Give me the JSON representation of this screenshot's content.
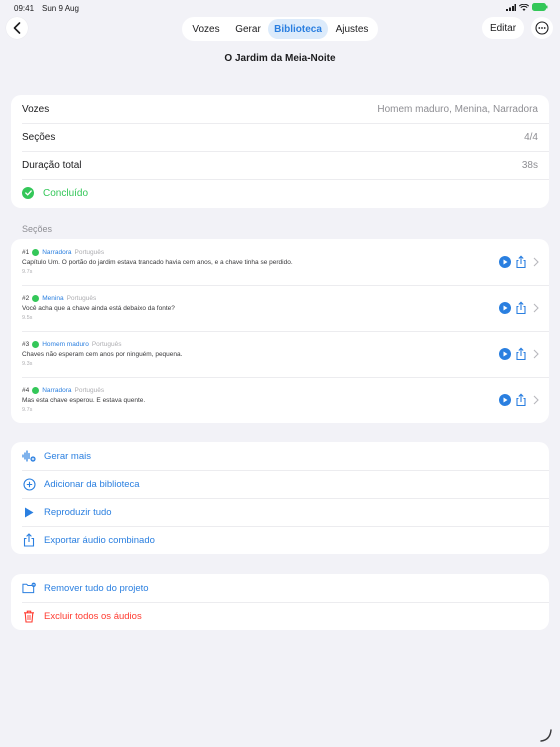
{
  "status": {
    "time": "09:41",
    "date": "Sun 9 Aug"
  },
  "nav": {
    "tabs": [
      {
        "label": "Vozes",
        "active": false
      },
      {
        "label": "Gerar",
        "active": false
      },
      {
        "label": "Biblioteca",
        "active": true
      },
      {
        "label": "Ajustes",
        "active": false
      }
    ],
    "edit_label": "Editar"
  },
  "title": "O Jardim da Meia-Noite",
  "summary": {
    "voices_label": "Vozes",
    "voices_value": "Homem maduro, Menina, Narradora",
    "sections_label": "Seções",
    "sections_value": "4/4",
    "duration_label": "Duração total",
    "duration_value": "38s",
    "status": "Concluído"
  },
  "sections_header": "Seções",
  "sections": [
    {
      "num": "#1",
      "voice": "Narradora",
      "lang": "Português",
      "text": "Capítulo Um. O portão do jardim estava trancado havia cem anos, e a chave tinha se perdido.",
      "duration": "9.7s"
    },
    {
      "num": "#2",
      "voice": "Menina",
      "lang": "Português",
      "text": "Você acha que a chave ainda está debaixo da fonte?",
      "duration": "9.5s"
    },
    {
      "num": "#3",
      "voice": "Homem maduro",
      "lang": "Português",
      "text": "Chaves não esperam cem anos por ninguém, pequena.",
      "duration": "9.3s"
    },
    {
      "num": "#4",
      "voice": "Narradora",
      "lang": "Português",
      "text": "Mas esta chave esperou. E estava quente.",
      "duration": "9.7s"
    }
  ],
  "actions": {
    "generate_more": "Gerar mais",
    "add_from_library": "Adicionar da biblioteca",
    "play_all": "Reproduzir tudo",
    "export_combined": "Exportar áudio combinado"
  },
  "danger": {
    "remove_all": "Remover tudo do projeto",
    "delete_all": "Excluir todos os áudios"
  },
  "colors": {
    "accent": "#2a7fe0",
    "success": "#34c759",
    "destructive": "#ff3b30"
  }
}
